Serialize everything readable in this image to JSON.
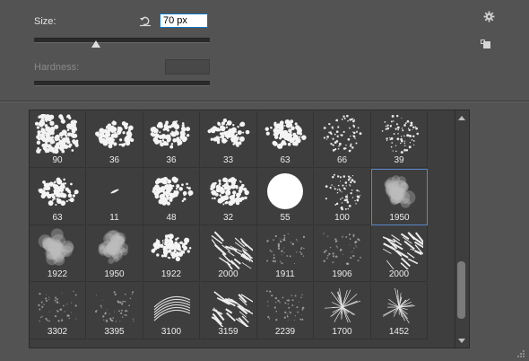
{
  "size": {
    "label": "Size:",
    "value": "70 px",
    "reset_icon": "reset-arrow-icon"
  },
  "hardness": {
    "label": "Hardness:",
    "value": ""
  },
  "toolbar": {
    "settings_icon": "gear-icon",
    "new_preset_icon": "new-preset-icon"
  },
  "brushes": [
    {
      "size": "90",
      "style": "dense"
    },
    {
      "size": "36",
      "style": "splat"
    },
    {
      "size": "36",
      "style": "splat"
    },
    {
      "size": "33",
      "style": "splat"
    },
    {
      "size": "63",
      "style": "splat"
    },
    {
      "size": "66",
      "style": "scatter"
    },
    {
      "size": "39",
      "style": "scatter"
    },
    {
      "size": "63",
      "style": "splat"
    },
    {
      "size": "11",
      "style": "dash"
    },
    {
      "size": "48",
      "style": "splat"
    },
    {
      "size": "32",
      "style": "splat"
    },
    {
      "size": "55",
      "style": "round"
    },
    {
      "size": "100",
      "style": "scatter"
    },
    {
      "size": "1950",
      "style": "smoke",
      "selected": true
    },
    {
      "size": "1922",
      "style": "smoke"
    },
    {
      "size": "1950",
      "style": "smoke"
    },
    {
      "size": "1922",
      "style": "splat"
    },
    {
      "size": "2000",
      "style": "streak"
    },
    {
      "size": "1911",
      "style": "faint"
    },
    {
      "size": "1906",
      "style": "faint"
    },
    {
      "size": "2000",
      "style": "streak"
    },
    {
      "size": "3302",
      "style": "faint"
    },
    {
      "size": "3395",
      "style": "faint"
    },
    {
      "size": "3100",
      "style": "swirl"
    },
    {
      "size": "3159",
      "style": "streak"
    },
    {
      "size": "2239",
      "style": "faint"
    },
    {
      "size": "1700",
      "style": "burst"
    },
    {
      "size": "1452",
      "style": "burst"
    }
  ]
}
